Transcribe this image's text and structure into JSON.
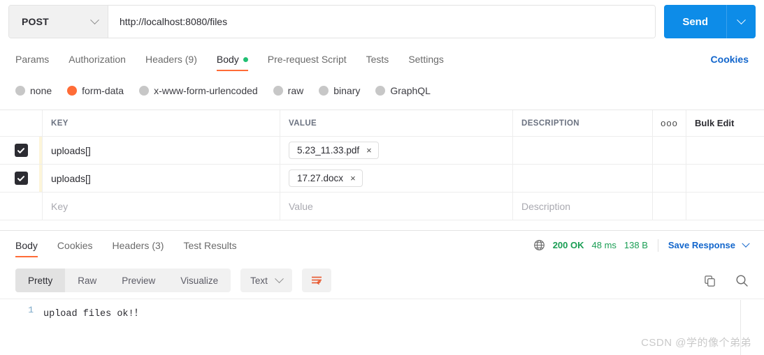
{
  "request": {
    "method": "POST",
    "url": "http://localhost:8080/files",
    "send_label": "Send",
    "tabs": [
      {
        "label": "Params",
        "active": false,
        "dot": false
      },
      {
        "label": "Authorization",
        "active": false,
        "dot": false
      },
      {
        "label": "Headers (9)",
        "active": false,
        "dot": false
      },
      {
        "label": "Body",
        "active": true,
        "dot": true
      },
      {
        "label": "Pre-request Script",
        "active": false,
        "dot": false
      },
      {
        "label": "Tests",
        "active": false,
        "dot": false
      },
      {
        "label": "Settings",
        "active": false,
        "dot": false
      }
    ],
    "cookies_link": "Cookies",
    "body_types": [
      {
        "label": "none",
        "selected": false
      },
      {
        "label": "form-data",
        "selected": true
      },
      {
        "label": "x-www-form-urlencoded",
        "selected": false
      },
      {
        "label": "raw",
        "selected": false
      },
      {
        "label": "binary",
        "selected": false
      },
      {
        "label": "GraphQL",
        "selected": false
      }
    ]
  },
  "form_table": {
    "headers": {
      "key": "KEY",
      "value": "VALUE",
      "description": "DESCRIPTION",
      "menu": "ooo",
      "bulk_edit": "Bulk Edit"
    },
    "rows": [
      {
        "checked": true,
        "key": "uploads[]",
        "file": "5.23_11.33.pdf",
        "remove": "×",
        "description": ""
      },
      {
        "checked": true,
        "key": "uploads[]",
        "file": "17.27.docx",
        "remove": "×",
        "description": ""
      }
    ],
    "placeholder_row": {
      "key": "Key",
      "value": "Value",
      "description": "Description"
    }
  },
  "response": {
    "tabs": [
      {
        "label": "Body",
        "active": true
      },
      {
        "label": "Cookies",
        "active": false
      },
      {
        "label": "Headers (3)",
        "active": false
      },
      {
        "label": "Test Results",
        "active": false
      }
    ],
    "status": "200 OK",
    "time": "48 ms",
    "size": "138 B",
    "save_label": "Save Response",
    "view_modes": [
      {
        "label": "Pretty",
        "active": true
      },
      {
        "label": "Raw",
        "active": false
      },
      {
        "label": "Preview",
        "active": false
      },
      {
        "label": "Visualize",
        "active": false
      }
    ],
    "format": "Text",
    "body_lines": [
      {
        "number": "1",
        "text": "upload files ok!！"
      }
    ]
  },
  "watermark": "CSDN @学的像个弟弟",
  "colors": {
    "accent": "#ff6c37",
    "send_blue": "#0d8ce8",
    "link_blue": "#1266cc",
    "status_green": "#1a9e54"
  }
}
